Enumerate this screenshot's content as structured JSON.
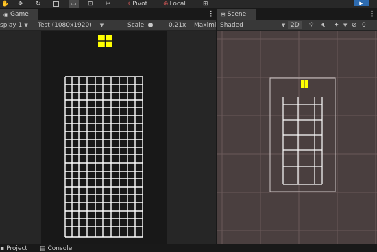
{
  "toolbar": {
    "pivot_label": "Pivot",
    "local_label": "Local",
    "play_icon": "play-icon"
  },
  "game": {
    "tab_label": "Game",
    "display_label": "splay 1",
    "resolution_label": "Test (1080x1920)",
    "scale_label": "Scale",
    "scale_value": "0.21x",
    "maximize_label": "Maximi"
  },
  "scene": {
    "tab_label": "Scene",
    "shading_label": "Shaded",
    "mode_2d_label": "2D",
    "hidden_count": "0"
  },
  "bottom": {
    "project_label": "Project",
    "console_label": "Console"
  },
  "colors": {
    "grid_line": "#ffffff",
    "piece": "#ffff00",
    "scene_bg": "#4a3f3f",
    "play_button": "#2d6bb0"
  }
}
